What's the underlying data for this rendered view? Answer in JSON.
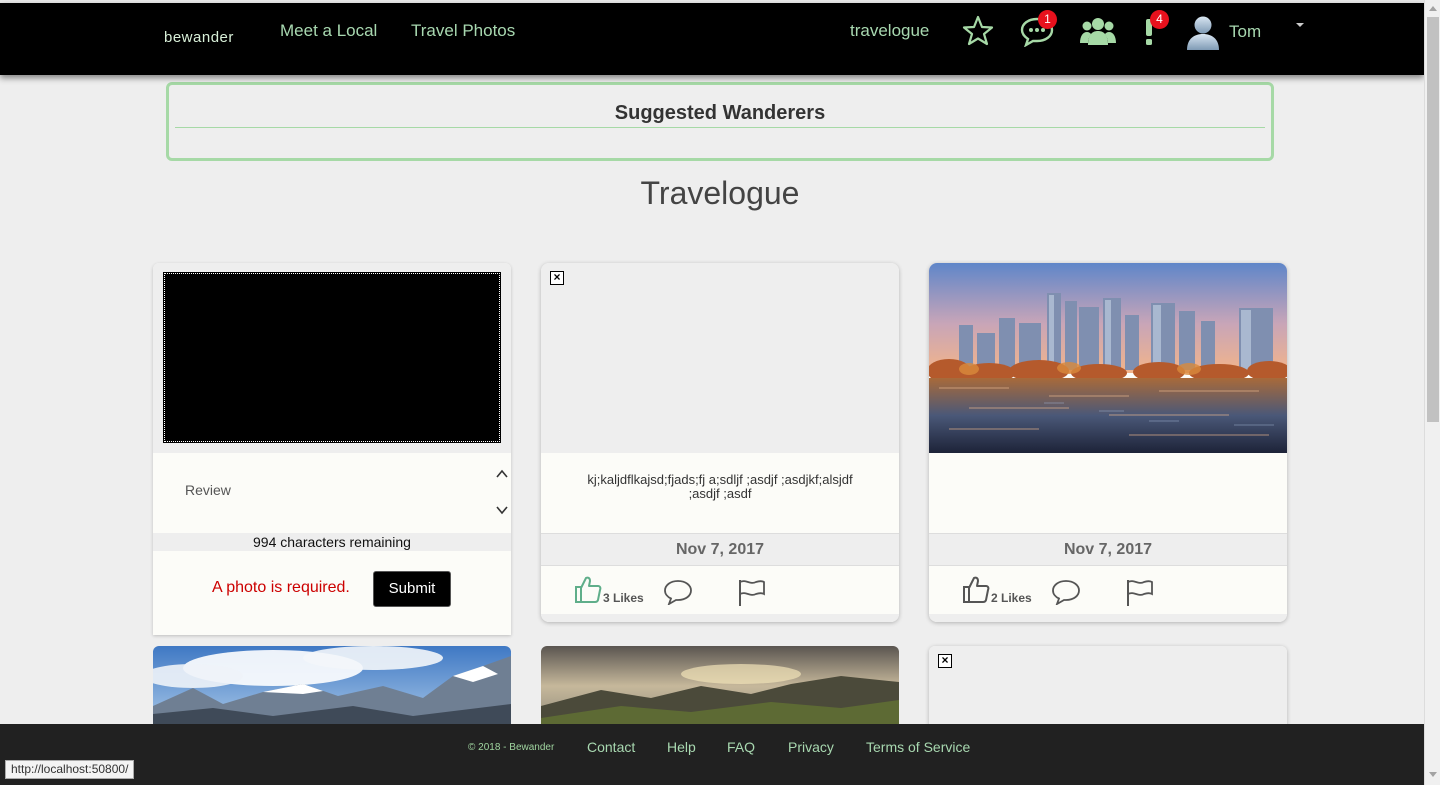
{
  "navbar": {
    "brand": "bewander",
    "links": [
      "Meet a Local",
      "Travel Photos"
    ],
    "right_link": "travelogue",
    "messages_badge": "1",
    "alerts_badge": "4",
    "user_name": "Tom"
  },
  "suggested": {
    "title": "Suggested Wanderers"
  },
  "page": {
    "title": "Travelogue"
  },
  "upload": {
    "review_placeholder": "Review",
    "chars_remaining": "994 characters remaining",
    "error": "A photo is required.",
    "submit_label": "Submit"
  },
  "posts": [
    {
      "text": "kj;kaljdflkajsd;fjads;fj a;sdljf ;asdjf ;asdjkf;alsjdf ;asdjf ;asdf",
      "date": "Nov 7, 2017",
      "likes": "3 Likes",
      "liked": true
    },
    {
      "text": "",
      "date": "Nov 7, 2017",
      "likes": "2 Likes",
      "liked": false
    }
  ],
  "footer": {
    "copyright": "© 2018 - Bewander",
    "links": [
      "Contact",
      "Help",
      "FAQ",
      "Privacy",
      "Terms of Service"
    ]
  },
  "status_bar": {
    "url": "http://localhost:50800/"
  },
  "colors": {
    "accent_green": "#a6d9a6",
    "nav_text": "#a8d8b0",
    "badge_red": "#e8111d",
    "error_red": "#cc0000"
  },
  "icons": [
    "star-icon",
    "messages-icon",
    "friends-icon",
    "alerts-icon",
    "user-avatar-icon",
    "thumbs-up-icon",
    "comment-icon",
    "flag-icon",
    "broken-image-icon"
  ]
}
